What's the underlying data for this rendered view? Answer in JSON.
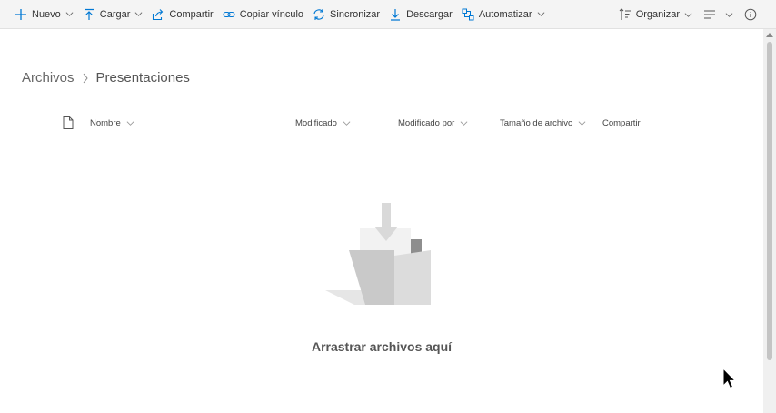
{
  "toolbar": {
    "nuevo": "Nuevo",
    "cargar": "Cargar",
    "compartir": "Compartir",
    "copiar_vinculo": "Copiar vínculo",
    "sincronizar": "Sincronizar",
    "descargar": "Descargar",
    "automatizar": "Automatizar",
    "organizar": "Organizar"
  },
  "breadcrumb": {
    "root": "Archivos",
    "current": "Presentaciones"
  },
  "columns": {
    "nombre": "Nombre",
    "modificado": "Modificado",
    "modificado_por": "Modificado por",
    "tamano": "Tamaño de archivo",
    "compartir": "Compartir"
  },
  "empty_state": {
    "message": "Arrastrar archivos aquí"
  },
  "colors": {
    "accent": "#0078d4",
    "toolbar_bg": "#f4f4f4"
  }
}
